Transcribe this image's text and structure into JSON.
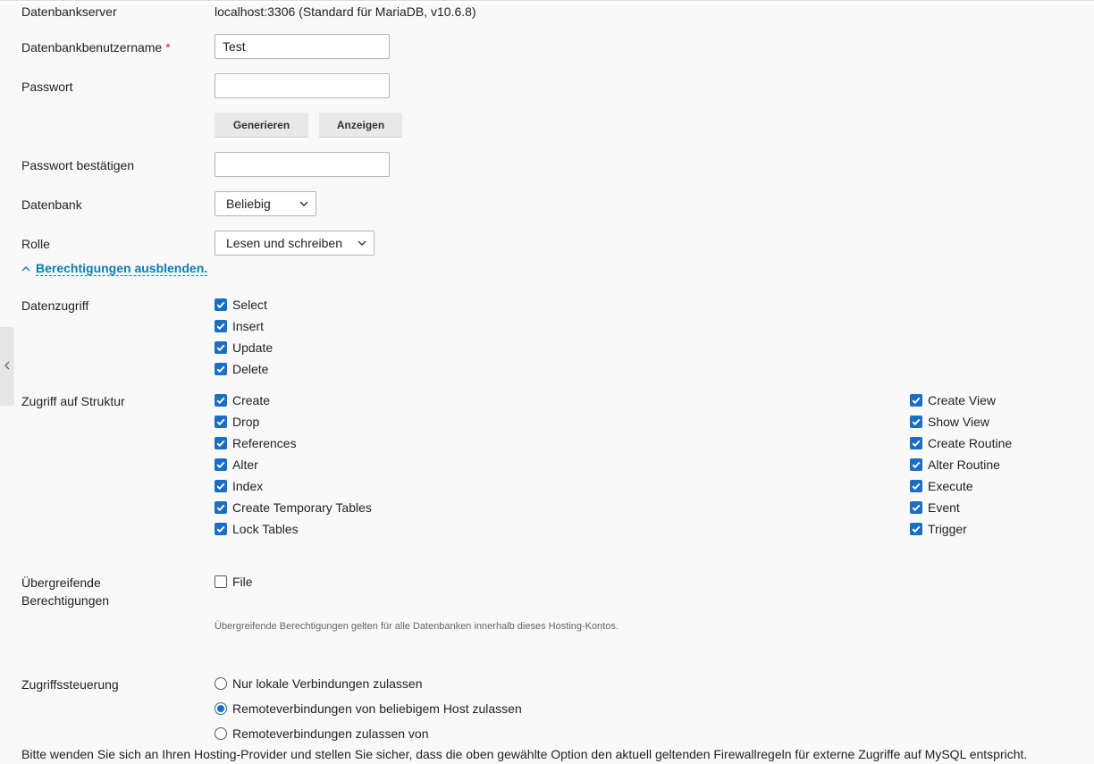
{
  "form": {
    "db_server": {
      "label": "Datenbankserver",
      "value": "localhost:3306 (Standard für MariaDB, v10.6.8)"
    },
    "username": {
      "label": "Datenbankbenutzername",
      "required_marker": "*",
      "value": "Test"
    },
    "password": {
      "label": "Passwort",
      "value": ""
    },
    "generate_button": "Generieren",
    "show_button": "Anzeigen",
    "password_confirm": {
      "label": "Passwort bestätigen",
      "value": ""
    },
    "database": {
      "label": "Datenbank",
      "selected": "Beliebig"
    },
    "role": {
      "label": "Rolle",
      "selected": "Lesen und schreiben"
    },
    "toggle_permissions": "Berechtigungen ausblenden."
  },
  "permissions": {
    "data_access": {
      "label": "Datenzugriff",
      "items": [
        {
          "label": "Select",
          "checked": true
        },
        {
          "label": "Insert",
          "checked": true
        },
        {
          "label": "Update",
          "checked": true
        },
        {
          "label": "Delete",
          "checked": true
        }
      ]
    },
    "structure_access": {
      "label": "Zugriff auf Struktur",
      "left": [
        {
          "label": "Create",
          "checked": true
        },
        {
          "label": "Drop",
          "checked": true
        },
        {
          "label": "References",
          "checked": true
        },
        {
          "label": "Alter",
          "checked": true
        },
        {
          "label": "Index",
          "checked": true
        },
        {
          "label": "Create Temporary Tables",
          "checked": true
        },
        {
          "label": "Lock Tables",
          "checked": true
        }
      ],
      "right": [
        {
          "label": "Create View",
          "checked": true
        },
        {
          "label": "Show View",
          "checked": true
        },
        {
          "label": "Create Routine",
          "checked": true
        },
        {
          "label": "Alter Routine",
          "checked": true
        },
        {
          "label": "Execute",
          "checked": true
        },
        {
          "label": "Event",
          "checked": true
        },
        {
          "label": "Trigger",
          "checked": true
        }
      ]
    },
    "global": {
      "label_line1": "Übergreifende",
      "label_line2": "Berechtigungen",
      "items": [
        {
          "label": "File",
          "checked": false
        }
      ],
      "hint": "Übergreifende Berechtigungen gelten für alle Datenbanken innerhalb dieses Hosting-Kontos."
    }
  },
  "access_control": {
    "label": "Zugriffssteuerung",
    "options": [
      {
        "label": "Nur lokale Verbindungen zulassen",
        "selected": false
      },
      {
        "label": "Remoteverbindungen von beliebigem Host zulassen",
        "selected": true
      },
      {
        "label": "Remoteverbindungen zulassen von",
        "selected": false
      }
    ]
  },
  "footnote": "Bitte wenden Sie sich an Ihren Hosting-Provider und stellen Sie sicher, dass die oben gewählte Option den aktuell geltenden Firewallregeln für externe Zugriffe auf MySQL entspricht.",
  "colors": {
    "accent": "#1a6fc4",
    "link": "#0a7db8",
    "required": "#d02d2d"
  }
}
